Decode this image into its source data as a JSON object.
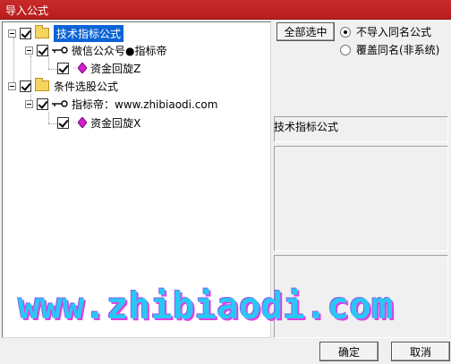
{
  "window": {
    "title": "导入公式"
  },
  "tree": {
    "nodes": [
      {
        "label": "技术指标公式",
        "checked": true,
        "selected": true
      },
      {
        "label": "微信公众号●指标帝",
        "checked": true
      },
      {
        "label": "资金回旋Z",
        "checked": true
      },
      {
        "label": "条件选股公式",
        "checked": true
      },
      {
        "label": "指标帝：www.zhibiaodi.com",
        "checked": true
      },
      {
        "label": "资金回旋X",
        "checked": true
      }
    ]
  },
  "options": {
    "select_all_label": "全部选中",
    "radio_no_import": "不导入同名公式",
    "radio_overwrite": "覆盖同名(非系统)"
  },
  "info": {
    "category_label": "技术指标公式"
  },
  "watermark": "www.zhibiaodi.com",
  "buttons": {
    "ok": "确定",
    "cancel": "取消"
  },
  "colors": {
    "titlebar": "#c0272d",
    "selection": "#0a64d6",
    "folder": "#f4d35e",
    "gem": "#d020d0",
    "watermark": "#28c8f5"
  }
}
